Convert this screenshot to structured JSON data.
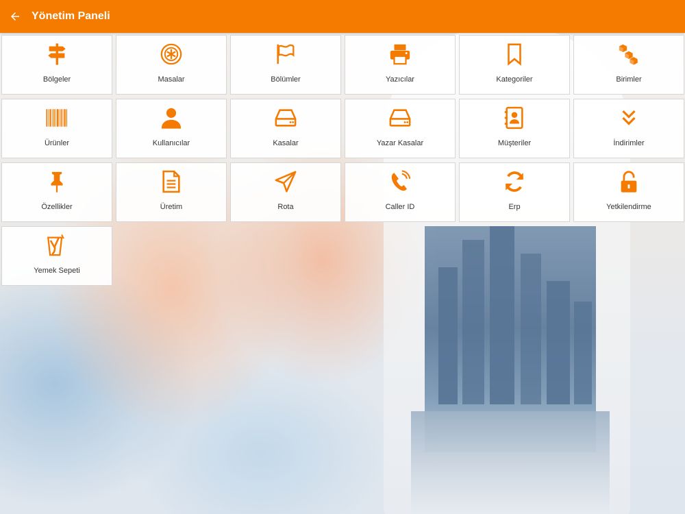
{
  "header": {
    "title": "Yönetim Paneli",
    "accent_color": "#f47a00"
  },
  "tiles": [
    {
      "label": "Bölgeler",
      "icon": "signpost-icon"
    },
    {
      "label": "Masalar",
      "icon": "table-medallion-icon"
    },
    {
      "label": "Bölümler",
      "icon": "flag-icon"
    },
    {
      "label": "Yazıcılar",
      "icon": "printer-icon"
    },
    {
      "label": "Kategoriler",
      "icon": "bookmark-icon"
    },
    {
      "label": "Birimler",
      "icon": "boxes-icon"
    },
    {
      "label": "Ürünler",
      "icon": "barcode-icon"
    },
    {
      "label": "Kullanıcılar",
      "icon": "user-icon"
    },
    {
      "label": "Kasalar",
      "icon": "drive-icon"
    },
    {
      "label": "Yazar Kasalar",
      "icon": "drive-icon"
    },
    {
      "label": "Müşteriler",
      "icon": "contacts-book-icon"
    },
    {
      "label": "İndirimler",
      "icon": "double-chevron-down-icon"
    },
    {
      "label": "Özellikler",
      "icon": "pushpin-icon"
    },
    {
      "label": "Üretim",
      "icon": "document-icon"
    },
    {
      "label": "Rota",
      "icon": "paper-plane-icon"
    },
    {
      "label": "Caller ID",
      "icon": "phone-ringing-icon"
    },
    {
      "label": "Erp",
      "icon": "sync-icon"
    },
    {
      "label": "Yetkilendirme",
      "icon": "unlock-icon"
    },
    {
      "label": "Yemek Sepeti",
      "icon": "yemeksepeti-logo-icon"
    }
  ]
}
